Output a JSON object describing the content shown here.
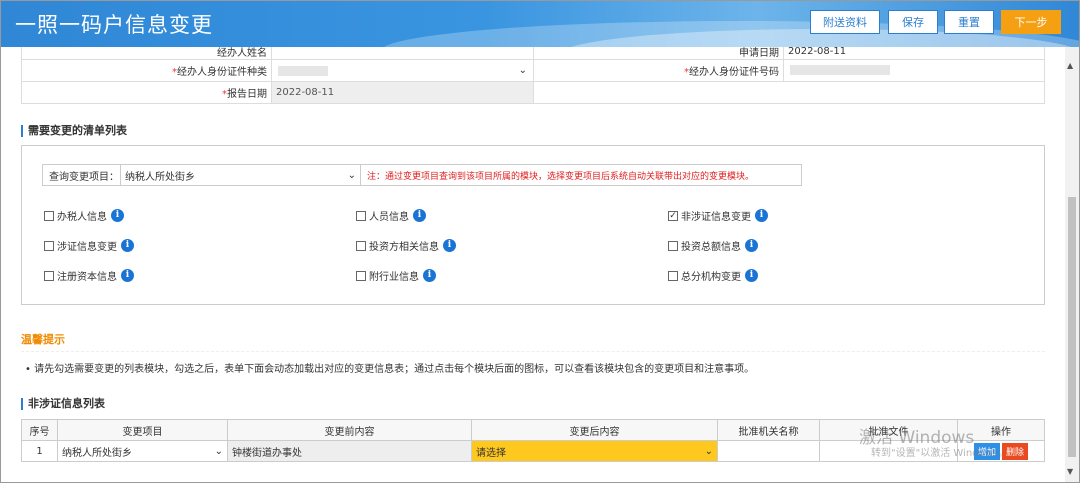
{
  "header": {
    "title": "一照一码户信息变更",
    "buttons": {
      "attach": "附送资料",
      "save": "保存",
      "reset": "重置",
      "next": "下一步"
    }
  },
  "form": {
    "row0": {
      "left_label": "经办人姓名",
      "right_label": "申请日期",
      "right_value": "2022-08-11"
    },
    "id_type": {
      "label": "经办人身份证件种类",
      "required": "*"
    },
    "id_number": {
      "label": "经办人身份证件号码",
      "required": "*"
    },
    "report_date": {
      "label": "报告日期",
      "required": "*",
      "value": "2022-08-11"
    }
  },
  "checklist": {
    "section_title": "需要变更的清单列表",
    "query_label": "查询变更项目：",
    "query_value": "纳税人所处街乡",
    "note": "注：通过变更项目查询到该项目所属的模块，选择变更项目后系统自动关联带出对应的变更模块。",
    "items": [
      {
        "label": "办税人信息",
        "checked": false
      },
      {
        "label": "人员信息",
        "checked": false
      },
      {
        "label": "非涉证信息变更",
        "checked": true
      },
      {
        "label": "涉证信息变更",
        "checked": false
      },
      {
        "label": "投资方相关信息",
        "checked": false
      },
      {
        "label": "投资总额信息",
        "checked": false
      },
      {
        "label": "注册资本信息",
        "checked": false
      },
      {
        "label": "附行业信息",
        "checked": false
      },
      {
        "label": "总分机构变更",
        "checked": false
      }
    ]
  },
  "tips": {
    "title": "温馨提示",
    "text": "• 请先勾选需要变更的列表模块，勾选之后，表单下面会动态加载出对应的变更信息表；通过点击每个模块后面的图标，可以查看该模块包含的变更项目和注意事项。"
  },
  "grid": {
    "section_title": "非涉证信息列表",
    "columns": [
      "序号",
      "变更项目",
      "变更前内容",
      "变更后内容",
      "批准机关名称",
      "批准文件",
      "操作"
    ],
    "rows": [
      {
        "no": "1",
        "item": "纳税人所处街乡",
        "before": "钟楼街道办事处",
        "after": "请选择",
        "authority": "",
        "document": "",
        "add": "增加",
        "del": "删除"
      }
    ]
  },
  "watermark": {
    "line1": "激活 Windows",
    "line2": "转到\"设置\"以激活 Windows。"
  },
  "colors": {
    "header": "#2f87d6",
    "next_button": "#f5a012",
    "tip_title": "#f08a00",
    "note": "#e02020",
    "after_cell": "#ffc81e"
  }
}
